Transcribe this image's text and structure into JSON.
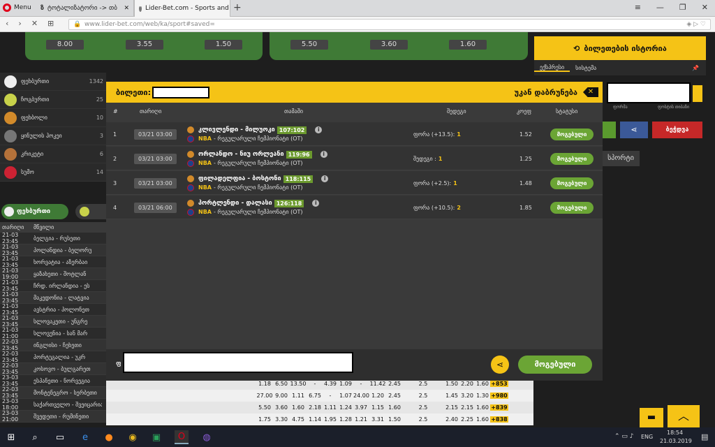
{
  "browser": {
    "menu_label": "Menu",
    "tabs": [
      {
        "title": "ტოტალიზატორი -> თბ"
      },
      {
        "title": "Lider-Bet.com - Sports and"
      }
    ],
    "url": "www.lider-bet.com/web/ka/sport#saved="
  },
  "top_odds": {
    "left": [
      "8.00",
      "3.55",
      "1.50"
    ],
    "right": [
      "5.50",
      "3.60",
      "1.60"
    ]
  },
  "sports": [
    {
      "name": "ფეხბურთი",
      "count": "1342"
    },
    {
      "name": "ჩოგბურთი",
      "count": "25"
    },
    {
      "name": "ფეხბოლი",
      "count": "10"
    },
    {
      "name": "ყინულის ჰოკეი",
      "count": "3"
    },
    {
      "name": "კრიკეტი",
      "count": "6"
    },
    {
      "name": "სუმო",
      "count": "14"
    }
  ],
  "sport_tab": {
    "active": "ფეხბურთი"
  },
  "match_table": {
    "headers": [
      "თარიღი",
      "მწვილი"
    ],
    "rows": [
      {
        "time": "21-03 23:45",
        "teams": "ბელგია - რუსეთი"
      },
      {
        "time": "21-03 23:45",
        "teams": "პოლანდია - ბელორუ"
      },
      {
        "time": "21-03 23:45",
        "teams": "ხორვატია - აზერბაი"
      },
      {
        "time": "21-03 19:00",
        "teams": "ყაზახეთი - შოტლან"
      },
      {
        "time": "21-03 23:45",
        "teams": "ჩრდ. ირლანდია - ეს"
      },
      {
        "time": "21-03 23:45",
        "teams": "მაკედონია - ლატვია"
      },
      {
        "time": "21-03 23:45",
        "teams": "ავსტრია - პოლონეთ"
      },
      {
        "time": "21-03 23:45",
        "teams": "სლოვაკეთი - უნგრე"
      },
      {
        "time": "21-03 21:00",
        "teams": "სლოვენია - სან მარ"
      },
      {
        "time": "22-03 23:45",
        "teams": "ინგლისი - ჩეხეთი"
      },
      {
        "time": "22-03 23:45",
        "teams": "პორტუგალია - უკრ"
      },
      {
        "time": "22-03 23:45",
        "teams": "კოსოვო - ბულგარეთ"
      },
      {
        "time": "23-03 23:45",
        "teams": "ესპანეთი - ნორვეგია"
      },
      {
        "time": "22-03 23:45",
        "teams": "მონტენეგრო - სერბეთი"
      },
      {
        "time": "23-03 18:00",
        "teams": "საქართველო - შვეიცარია"
      },
      {
        "time": "23-03 21:00",
        "teams": "შვედეთი - რუმინეთი"
      }
    ],
    "visible_odds": [
      [
        "1.18",
        "6.50",
        "13.50",
        "-",
        "4.39",
        "1.09",
        "-",
        "11.42",
        "2.45",
        "2.5",
        "1.50",
        "2.20",
        "1.60",
        "+853"
      ],
      [
        "27.00",
        "9.00",
        "1.11",
        "6.75",
        "-",
        "1.07",
        "24.00",
        "1.20",
        "2.45",
        "2.5",
        "1.45",
        "3.20",
        "1.30",
        "+980"
      ],
      [
        "5.50",
        "3.60",
        "1.60",
        "2.18",
        "1.11",
        "1.24",
        "3.97",
        "1.15",
        "1.60",
        "2.5",
        "2.15",
        "2.15",
        "1.60",
        "+839"
      ],
      [
        "1.75",
        "3.30",
        "4.75",
        "1.14",
        "1.95",
        "1.28",
        "1.21",
        "3.31",
        "1.50",
        "2.5",
        "2.40",
        "2.25",
        "1.60",
        "+838"
      ]
    ]
  },
  "right_panel": {
    "history_title": "ბილეთების ისტორია",
    "tabs": [
      "ექსპრესი",
      "სისტემა"
    ],
    "labels": [
      "ფორმა",
      "ფოსტის თიბაზი"
    ],
    "other_tab": "სპორტი",
    "button_label": "ბეჭდვა"
  },
  "modal": {
    "ticket_label": "ბილეთი:",
    "back_label": "უკან დაბრუნება",
    "columns": [
      "#",
      "თარიღი",
      "თამაში",
      "შედეგი",
      "კოეფ",
      "სტატუსი"
    ],
    "bets": [
      {
        "n": "1",
        "date": "03/21 03:00",
        "match": "კლივლენდი - მილუოკი",
        "score": "107:102",
        "league": "NBA",
        "league_sub": "- რეგულარული ჩემპიონატი (OT)",
        "result_text": "ფორა (+13.5):",
        "result_val": "1",
        "coef": "1.52",
        "status": "მოგებული"
      },
      {
        "n": "2",
        "date": "03/21 03:00",
        "match": "ორლანდო - ნიუ ორლეანი",
        "score": "119:96",
        "league": "NBA",
        "league_sub": "- რეგულარული ჩემპიონატი (OT)",
        "result_text": "შედეგი :",
        "result_val": "1",
        "coef": "1.25",
        "status": "მოგებული"
      },
      {
        "n": "3",
        "date": "03/21 03:00",
        "match": "ფილადელფია - ბოსტონი",
        "score": "118:115",
        "league": "NBA",
        "league_sub": "- რეგულარული ჩემპიონატი (OT)",
        "result_text": "ფორა (+2.5):",
        "result_val": "1",
        "coef": "1.48",
        "status": "მოგებული"
      },
      {
        "n": "4",
        "date": "03/21 06:00",
        "match": "პორტლენდი - დალასი",
        "score": "126:118",
        "league": "NBA",
        "league_sub": "- რეგულარული ჩემპიონატი (OT)",
        "result_text": "ფორა (+10.5):",
        "result_val": "2",
        "coef": "1.85",
        "status": "მოგებული"
      }
    ],
    "footer_label": "ფ",
    "footer_status": "მოგებული"
  },
  "taskbar": {
    "lang": "ENG",
    "time": "18:54",
    "date": "21.03.2019"
  },
  "colors": {
    "accent": "#f5c316",
    "win": "#6ba535",
    "share": "#f5c316"
  }
}
